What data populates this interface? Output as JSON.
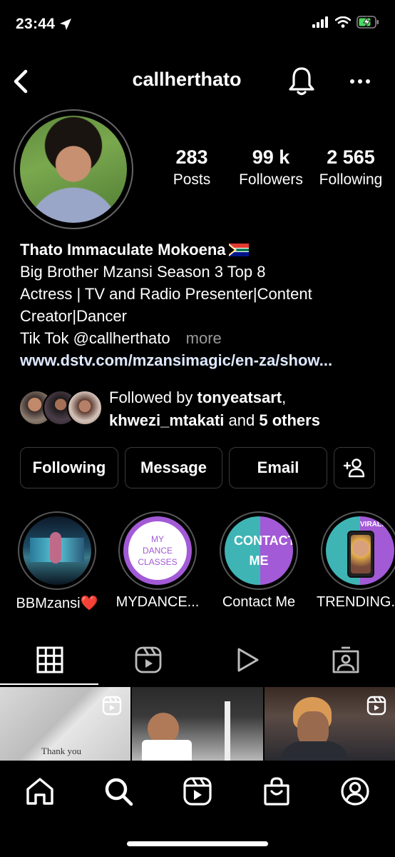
{
  "status_bar": {
    "time": "23:44"
  },
  "header": {
    "username": "callherthato"
  },
  "stats": [
    {
      "value": "283",
      "label": "Posts"
    },
    {
      "value": "99 k",
      "label": "Followers"
    },
    {
      "value": "2 565",
      "label": "Following"
    }
  ],
  "bio": {
    "name": "Thato Immaculate Mokoena",
    "line1": "Big Brother Mzansi Season 3 Top 8",
    "line2": "Actress | TV and Radio Presenter|Content",
    "line3": "Creator|Dancer",
    "line4": "Tik Tok @callherthato",
    "more": "more",
    "link": "www.dstv.com/mzansimagic/en-za/show..."
  },
  "followed_by": {
    "prefix": "Followed by ",
    "user1": "tonyeatsart",
    "sep": ",",
    "user2": "khwezi_mtakati",
    "middle": " and ",
    "others": "5 others"
  },
  "actions": {
    "following": "Following",
    "message": "Message",
    "email": "Email"
  },
  "highlights": [
    {
      "label": "BBMzansi❤️",
      "content": ""
    },
    {
      "label": "MYDANCE...",
      "content": "MY DANCE CLASSES"
    },
    {
      "label": "Contact Me",
      "content": "CONTACT ME"
    },
    {
      "label": "TRENDING...",
      "content": "VIRAL!"
    }
  ],
  "grid": {
    "post1_text": "Thank you"
  },
  "colors": {
    "background": "#000000",
    "link": "#dfe9ff",
    "muted": "#9a9a9a",
    "highlight_teal": "#3fb4b5",
    "highlight_purple": "#a35ad6",
    "battery": "#4cd964"
  },
  "icons": {
    "header": [
      "back-icon",
      "bell-icon",
      "more-icon"
    ],
    "tabs": [
      "grid-icon",
      "reels-icon",
      "play-icon",
      "tagged-icon"
    ],
    "nav": [
      "home-icon",
      "search-icon",
      "reels-icon",
      "shop-icon",
      "profile-icon"
    ]
  }
}
